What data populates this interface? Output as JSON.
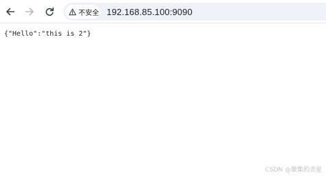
{
  "toolbar": {
    "back_icon": "arrow-left-icon",
    "forward_icon": "arrow-right-icon",
    "reload_icon": "reload-icon",
    "security_icon": "warning-triangle-icon",
    "security_label": "不安全",
    "url": "192.168.85.100:9090"
  },
  "page": {
    "body_text": "{\"Hello\":\"this is 2\"}"
  },
  "watermark": {
    "text": "CSDN @聚集的流星"
  },
  "colors": {
    "omnibox_bg": "#eef1f6",
    "icon_active": "#3c4043",
    "icon_disabled": "#b5b8bc",
    "watermark": "#c4c4c4"
  }
}
